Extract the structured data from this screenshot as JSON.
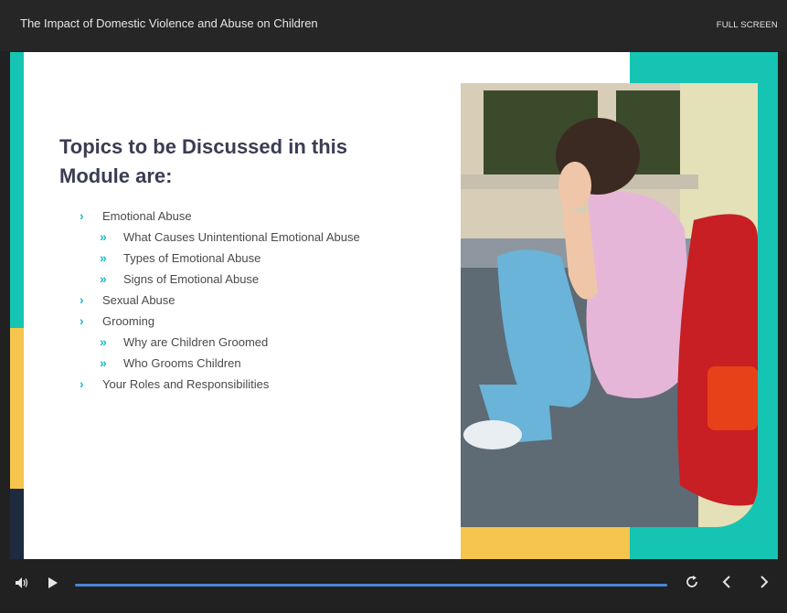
{
  "header": {
    "title": "The Impact of Domestic Violence and Abuse on Children",
    "fullscreen_label": "FULL SCREEN"
  },
  "slide": {
    "heading": "Topics to be Discussed in this Module are:",
    "topics": [
      {
        "level": 1,
        "label": "Emotional Abuse"
      },
      {
        "level": 2,
        "label": "What Causes Unintentional Emotional Abuse"
      },
      {
        "level": 2,
        "label": "Types of Emotional Abuse"
      },
      {
        "level": 2,
        "label": "Signs of Emotional Abuse"
      },
      {
        "level": 1,
        "label": "Sexual Abuse"
      },
      {
        "level": 1,
        "label": "Grooming"
      },
      {
        "level": 2,
        "label": "Why are Children Groomed"
      },
      {
        "level": 2,
        "label": "Who Grooms Children"
      },
      {
        "level": 1,
        "label": "Your Roles and Responsibilities"
      }
    ],
    "colors": {
      "teal": "#16c4b3",
      "yellow": "#f5c54e",
      "navy": "#1e2a3e",
      "heading": "#3a3d52",
      "bullet": "#1fb8c6"
    }
  },
  "player": {
    "icons": {
      "volume": "volume-icon",
      "play": "play-icon",
      "replay": "replay-icon",
      "prev": "chevron-left-icon",
      "next": "chevron-right-icon"
    },
    "progress_color": "#4a86d6"
  }
}
